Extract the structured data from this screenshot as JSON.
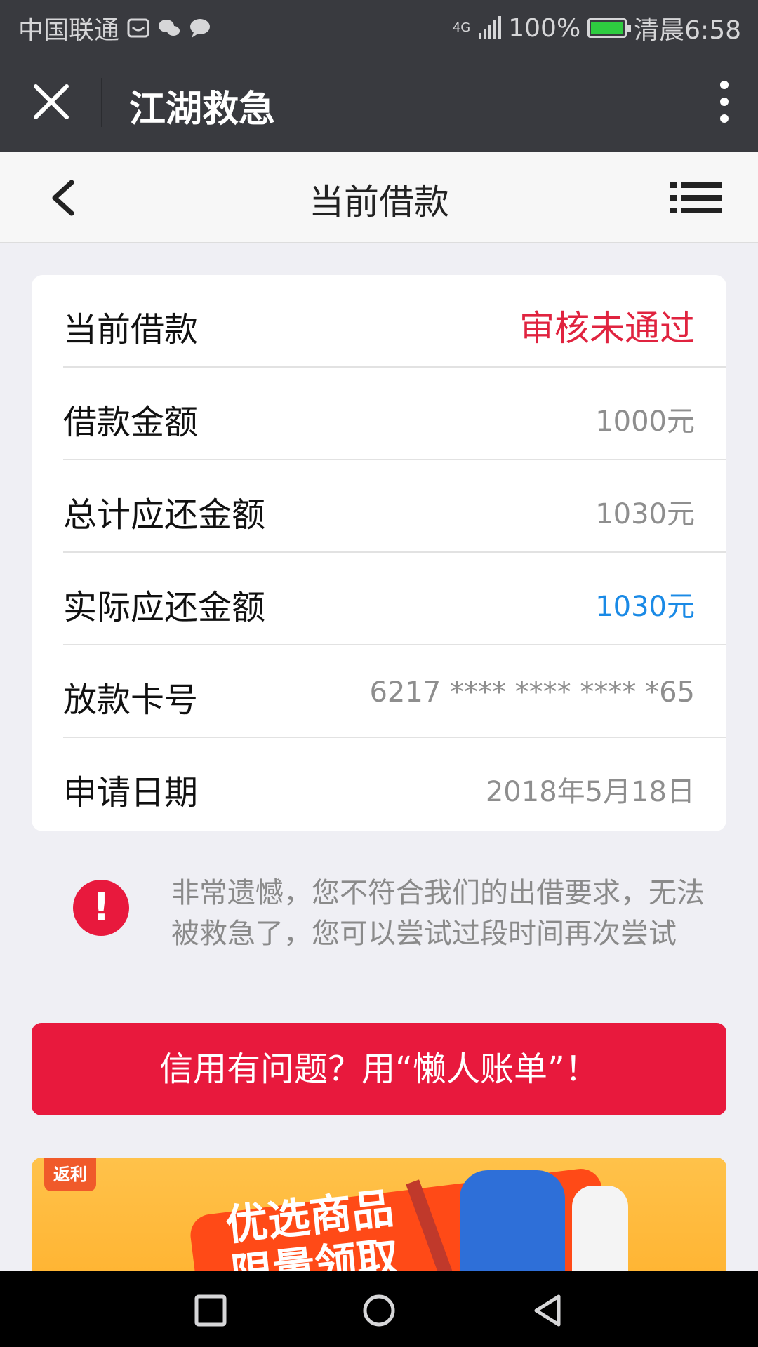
{
  "status_bar": {
    "carrier": "中国联通",
    "network": "4G",
    "battery": "100%",
    "time": "清晨6:58"
  },
  "titlebar": {
    "title": "江湖救急"
  },
  "page_header": {
    "title": "当前借款"
  },
  "loan": {
    "rows": [
      {
        "label": "当前借款",
        "value": "审核未通过"
      },
      {
        "label": "借款金额",
        "value": "1000元"
      },
      {
        "label": "总计应还金额",
        "value": "1030元"
      },
      {
        "label": "实际应还金额",
        "value": "1030元"
      },
      {
        "label": "放款卡号",
        "value": "6217 **** **** **** *65"
      },
      {
        "label": "申请日期",
        "value": "2018年5月18日"
      }
    ]
  },
  "notice": {
    "icon": "!",
    "text": "非常遗憾，您不符合我们的出借要求，无法被救急了，您可以尝试过段时间再次尝试"
  },
  "cta": {
    "label": "信用有问题？用“懒人账单”！"
  },
  "banner": {
    "logo": "返利",
    "text_line1": "优选商品",
    "text_line2": "限量领取"
  },
  "colors": {
    "accent_red": "#e8193d",
    "value_blue": "#1a8ae6",
    "dark_bar": "#393a3f"
  }
}
